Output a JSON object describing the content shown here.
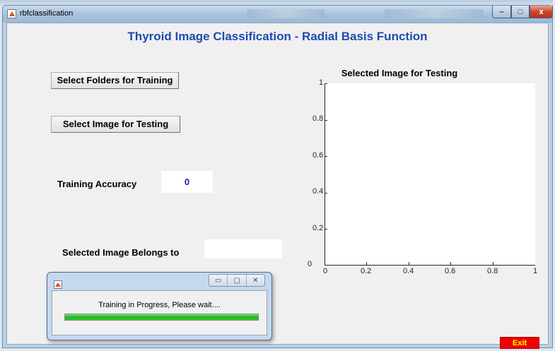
{
  "window": {
    "title": "rbfclassification",
    "controls": {
      "minimize": "–",
      "maximize": "□",
      "close": "x"
    }
  },
  "heading": "Thyroid Image Classification - Radial Basis Function",
  "buttons": {
    "select_folders": "Select Folders for Training",
    "select_image": "Select Image for Testing",
    "exit": "Exit"
  },
  "training_accuracy": {
    "label": "Training Accuracy",
    "value": "0"
  },
  "belongs_to": {
    "label": "Selected Image Belongs to",
    "value": ""
  },
  "axes": {
    "title": "Selected Image for Testing",
    "y_ticks": [
      "0",
      "0.2",
      "0.4",
      "0.6",
      "0.8",
      "1"
    ],
    "x_ticks": [
      "0",
      "0.2",
      "0.4",
      "0.6",
      "0.8",
      "1"
    ]
  },
  "progress_dialog": {
    "message": "Training in Progress, Please wait....",
    "progress": 1.0,
    "controls": {
      "minimize": "▭",
      "maximize": "▢",
      "close": "✕"
    }
  },
  "colors": {
    "heading": "#1f4bb4",
    "accuracy_value": "#1a1ab8",
    "exit_bg": "#f00000",
    "exit_text": "#ffff00",
    "progress": "#1ab51a"
  }
}
